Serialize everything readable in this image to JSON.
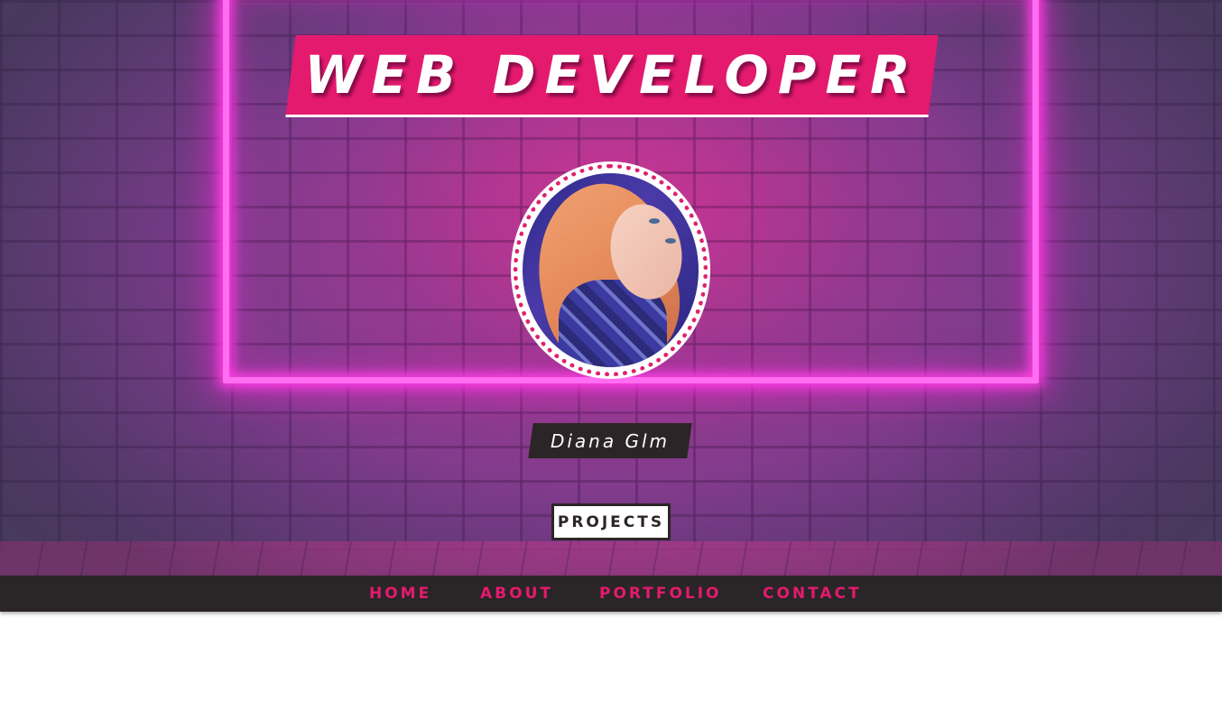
{
  "hero": {
    "title": "WEB DEVELOPER",
    "name": "Diana Glm",
    "projects_button": "PROJECTS",
    "avatar_alt": "profile photo"
  },
  "nav": {
    "items": [
      {
        "label": "HOME"
      },
      {
        "label": "ABOUT"
      },
      {
        "label": "PORTFOLIO"
      },
      {
        "label": "CONTACT"
      }
    ]
  },
  "colors": {
    "accent_pink": "#e41a6e",
    "neon": "#ff6df2",
    "dark": "#2a2527",
    "white": "#ffffff"
  },
  "icons": [
    "neon-frame",
    "profile-avatar"
  ]
}
